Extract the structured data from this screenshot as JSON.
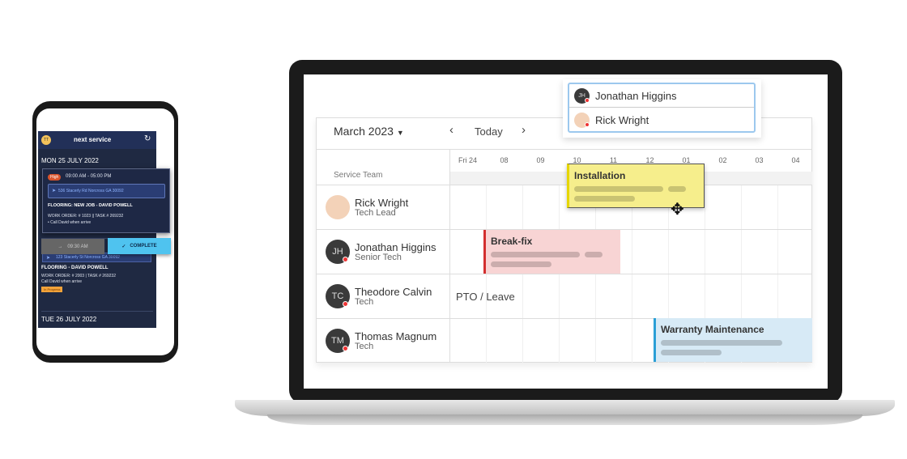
{
  "phone": {
    "avatar": "TT",
    "brand": "next service",
    "date": "MON 25 JULY 2022",
    "job1": {
      "priority": "High",
      "time": "09:00 AM - 05:00 PM",
      "address": "536 Stacerly Rd Norcross GA 30092",
      "title": "FLOORING: NEW JOB - DAVID POWELL",
      "work_order": "WORK ORDER: # 1023 || TASK # 269232",
      "note": "• Call David when arrive"
    },
    "checkin_label": "09:30 AM",
    "complete_label": "COMPLETE",
    "job2": {
      "address": "123 Stacerly St Norcross GA 30092",
      "title": "FLOORING - DAVID POWELL",
      "work_order": "WORK ORDER: # 2003 | TASK # 269232",
      "note": "Call David when arrive",
      "status": "In Progress"
    },
    "next_date": "TUE 26 JULY 2022"
  },
  "calendar": {
    "month": "March 2023",
    "today": "Today",
    "team_label": "Service Team",
    "hours": [
      "Fri 24",
      "08",
      "09",
      "10",
      "11",
      "12",
      "01",
      "02",
      "03",
      "04"
    ],
    "techs": [
      {
        "name": "Rick Wright",
        "role": "Tech Lead",
        "initials": ""
      },
      {
        "name": "Jonathan Higgins",
        "role": "Senior Tech",
        "initials": "JH"
      },
      {
        "name": "Theodore Calvin",
        "role": "Tech",
        "initials": "TC"
      },
      {
        "name": "Thomas Magnum",
        "role": "Tech",
        "initials": "TM"
      }
    ],
    "events": {
      "installation": "Installation",
      "breakfix": "Break-fix",
      "pto": "PTO / Leave",
      "warranty": "Warranty Maintenance"
    },
    "dropdown": [
      {
        "name": "Jonathan Higgins",
        "initials": "JH"
      },
      {
        "name": "Rick Wright",
        "initials": ""
      }
    ]
  },
  "colors": {
    "installation": "#f6ee8c",
    "breakfix": "#f8d4d4",
    "warranty": "#d7eaf6",
    "complete": "#4fc3ef",
    "phone_bg": "#1f2942"
  }
}
